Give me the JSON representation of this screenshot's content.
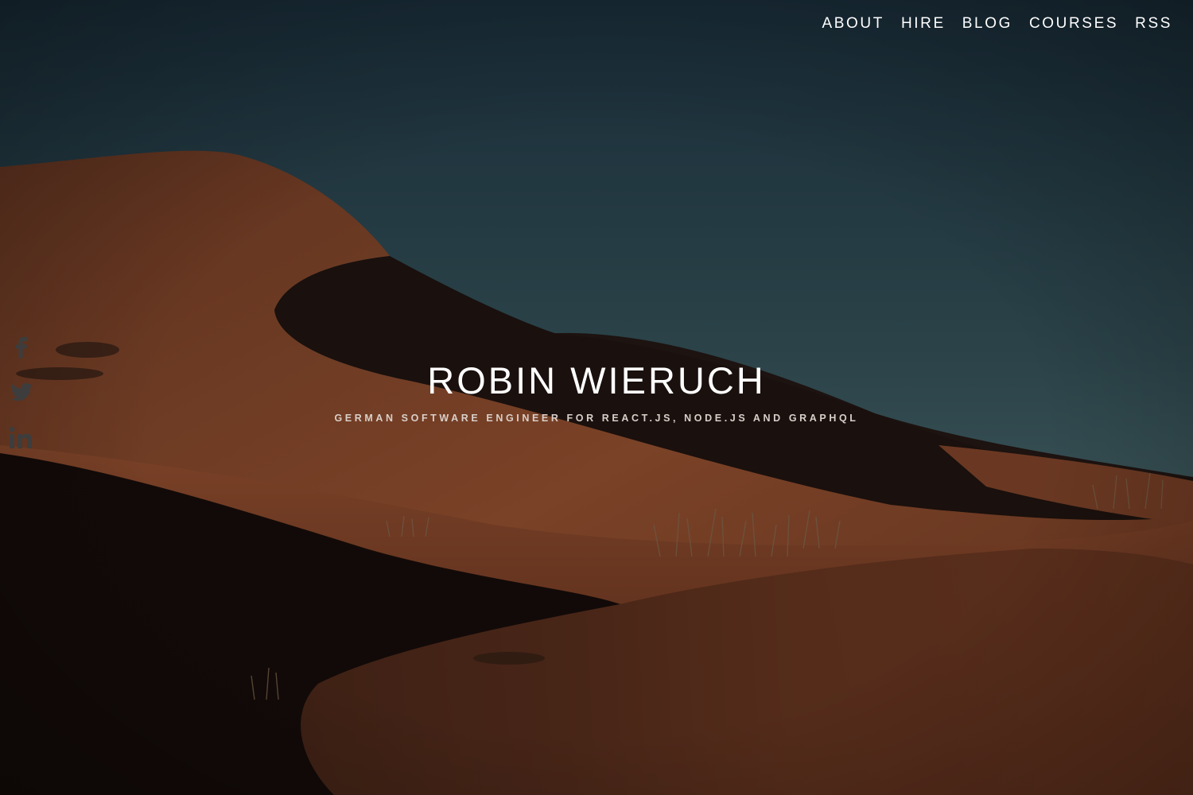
{
  "nav": {
    "items": [
      {
        "label": "ABOUT"
      },
      {
        "label": "HIRE"
      },
      {
        "label": "BLOG"
      },
      {
        "label": "COURSES"
      },
      {
        "label": "RSS"
      }
    ]
  },
  "social": {
    "icons": [
      "facebook-icon",
      "twitter-icon",
      "linkedin-icon"
    ],
    "icon_color": "#3d3d3d"
  },
  "hero": {
    "title": "ROBIN WIERUCH",
    "subtitle": "GERMAN SOFTWARE ENGINEER FOR REACT.JS, NODE.JS AND GRAPHQL"
  },
  "colors": {
    "sky_top": "#1b2f3c",
    "sky_bottom": "#3a5558",
    "sand_lit": "#7a4126",
    "sand_shadow": "#1a0f0c"
  }
}
